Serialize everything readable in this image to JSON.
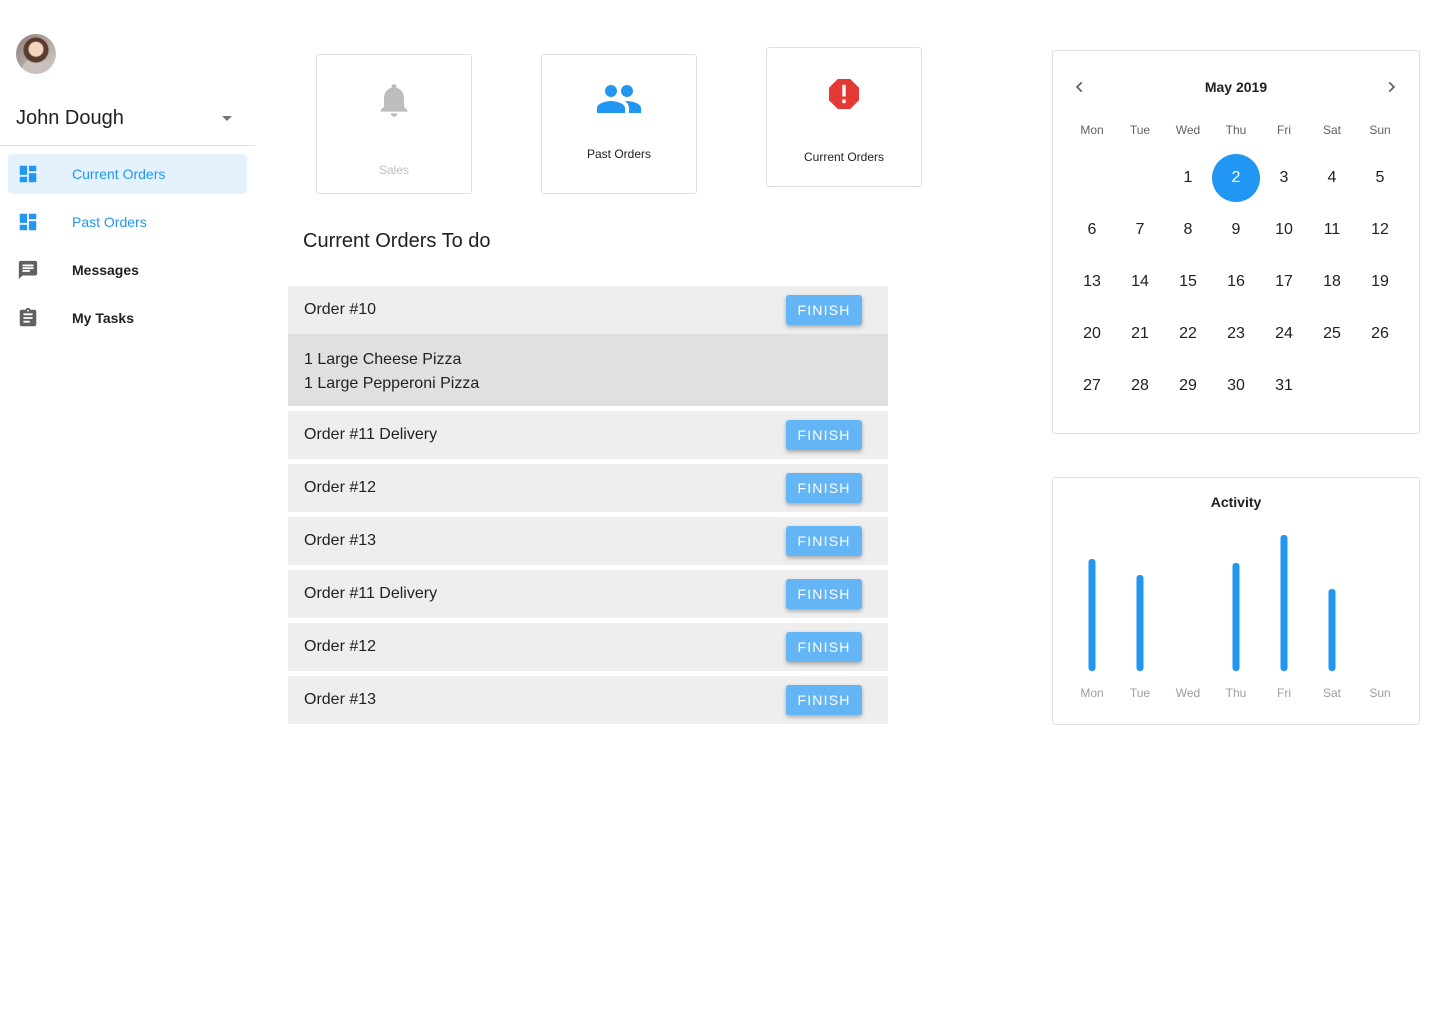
{
  "user": {
    "name": "John Dough"
  },
  "sidebar": {
    "items": [
      {
        "label": "Current Orders",
        "icon": "dashboard-icon"
      },
      {
        "label": "Past Orders",
        "icon": "dashboard-icon"
      },
      {
        "label": "Messages",
        "icon": "message-icon"
      },
      {
        "label": "My Tasks",
        "icon": "clipboard-icon"
      }
    ]
  },
  "cards": [
    {
      "label": "Sales",
      "icon": "bell-icon",
      "disabled": true
    },
    {
      "label": "Past Orders",
      "icon": "people-icon"
    },
    {
      "label": "Current Orders",
      "icon": "alert-octagon-icon"
    }
  ],
  "orders_section": {
    "title": "Current Orders To do",
    "finish_label": "FINISH",
    "orders": [
      {
        "title": "Order #10",
        "details": [
          "1 Large Cheese Pizza",
          "1 Large Pepperoni Pizza"
        ]
      },
      {
        "title": "Order #11 Delivery"
      },
      {
        "title": "Order #12"
      },
      {
        "title": "Order #13"
      },
      {
        "title": "Order #11 Delivery"
      },
      {
        "title": "Order #12"
      },
      {
        "title": "Order #13"
      }
    ]
  },
  "calendar": {
    "title": "May 2019",
    "weekdays": [
      "Mon",
      "Tue",
      "Wed",
      "Thu",
      "Fri",
      "Sat",
      "Sun"
    ],
    "leading_blanks": 2,
    "days": 31,
    "selected_day": 2
  },
  "chart_data": {
    "type": "bar",
    "title": "Activity",
    "categories": [
      "Mon",
      "Tue",
      "Wed",
      "Thu",
      "Fri",
      "Sat",
      "Sun"
    ],
    "values": [
      112,
      96,
      0,
      108,
      136,
      82,
      0
    ],
    "ylim": [
      0,
      140
    ],
    "grid": false,
    "color": "#2196f3"
  },
  "colors": {
    "accent": "#2196f3",
    "button": "#64b5f6",
    "alert": "#e53935",
    "row": "#eeeeee"
  }
}
